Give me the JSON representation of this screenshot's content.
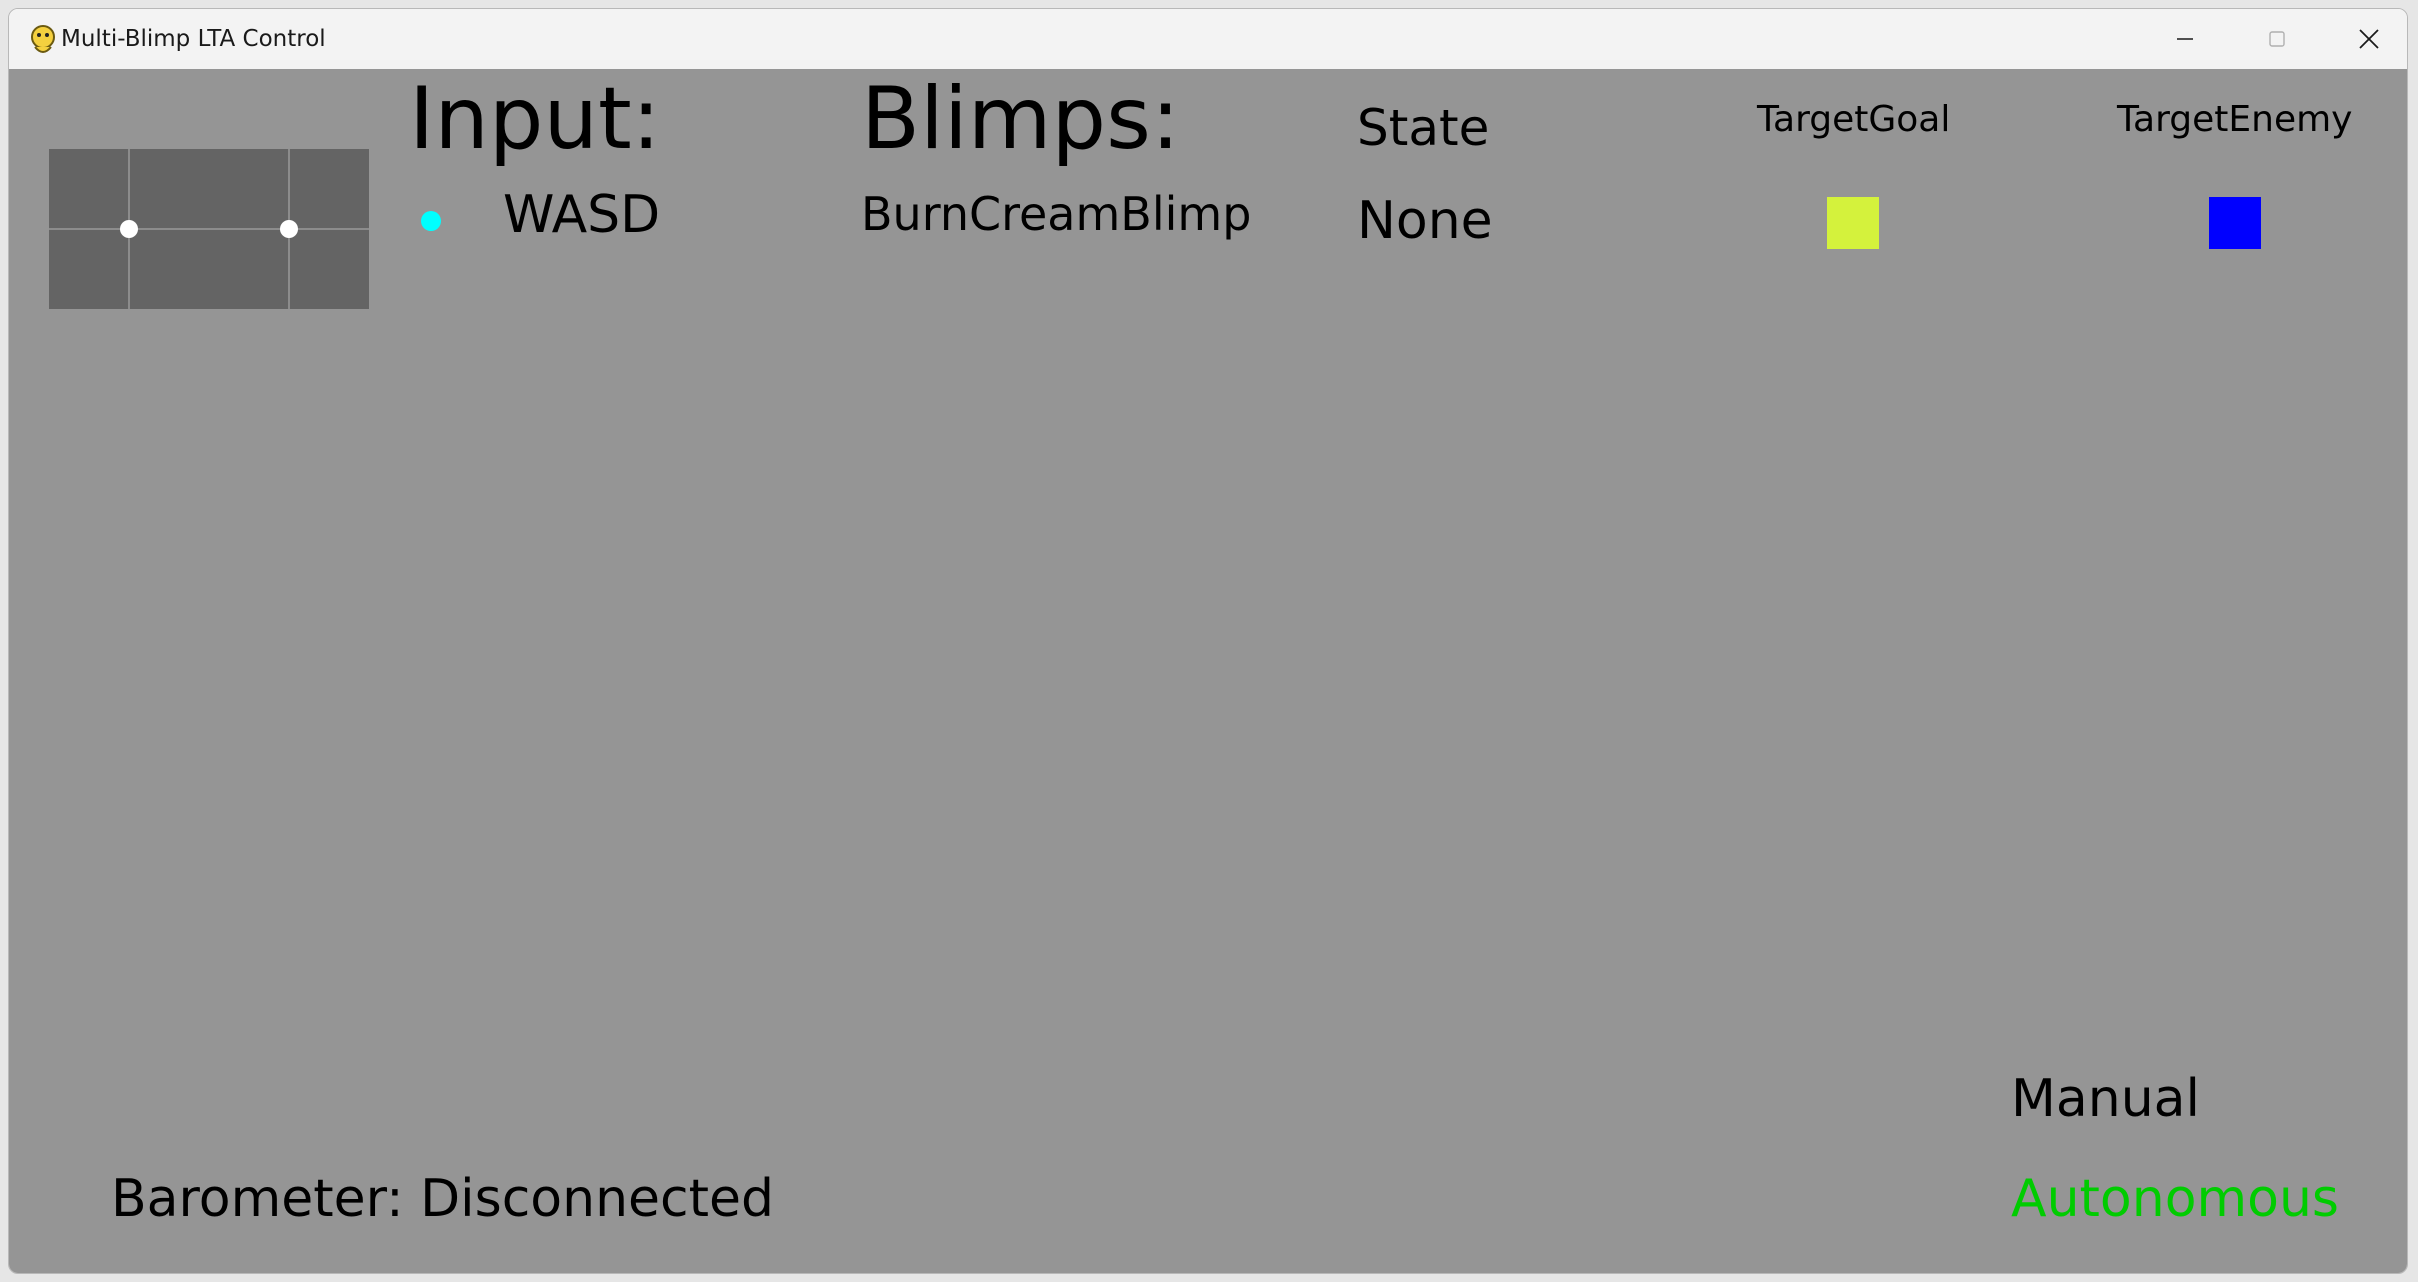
{
  "window": {
    "title": "Multi-Blimp LTA Control",
    "icon": "python-snake-icon"
  },
  "titlebar_buttons": [
    "minimize-icon",
    "maximize-icon",
    "close-icon"
  ],
  "joystick": {
    "left_stick": "dot",
    "right_stick": "dot"
  },
  "input": {
    "heading": "Input:",
    "items": [
      {
        "label": "WASD",
        "indicator_color": "#00ffff"
      }
    ]
  },
  "blimps": {
    "heading": "Blimps:",
    "columns": {
      "state": "State",
      "target_goal": "TargetGoal",
      "target_enemy": "TargetEnemy"
    },
    "rows": [
      {
        "name": "BurnCreamBlimp",
        "state": "None",
        "target_goal_color": "#d4f23c",
        "target_enemy_color": "#0000ff"
      }
    ]
  },
  "modes": {
    "manual": {
      "label": "Manual",
      "color": "#000000"
    },
    "autonomous": {
      "label": "Autonomous",
      "color": "#00cc00"
    }
  },
  "barometer": {
    "text": "Barometer: Disconnected"
  },
  "colors": {
    "background": "#959595",
    "joystick_panel": "#646464",
    "joystick_grid": "#8c8c8c"
  }
}
